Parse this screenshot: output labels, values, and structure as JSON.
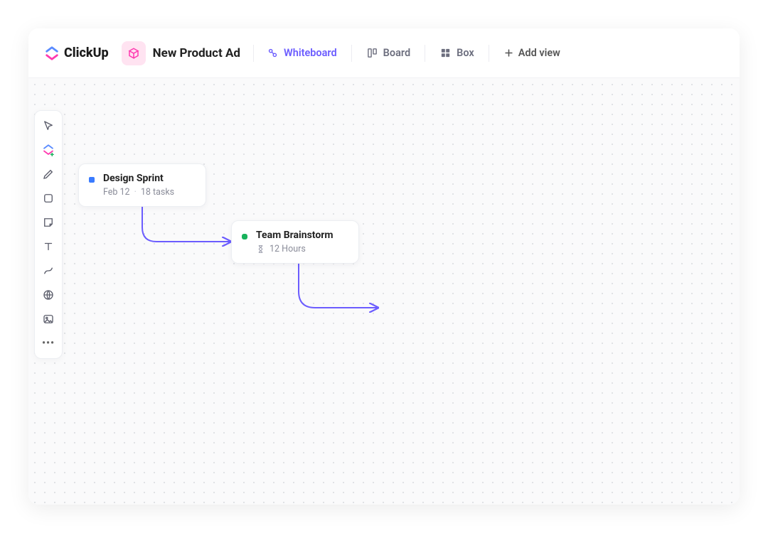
{
  "app": {
    "name": "ClickUp"
  },
  "project": {
    "name": "New Product Ad"
  },
  "tabs": {
    "whiteboard": "Whiteboard",
    "board": "Board",
    "box": "Box",
    "add": "Add view"
  },
  "toolbox": {
    "cursor": "cursor",
    "clickup": "clickup-shape",
    "pen": "pen",
    "rect": "rectangle",
    "note": "sticky-note",
    "text": "text",
    "connector": "connector",
    "web": "web-embed",
    "image": "image",
    "more": "more"
  },
  "cards": {
    "c1": {
      "title": "Design Sprint",
      "date": "Feb 12",
      "tasks": "18 tasks"
    },
    "c2": {
      "title": "Team Brainstorm",
      "time": "12 Hours"
    }
  },
  "colors": {
    "accent": "#6b5cff",
    "pink": "#ff3ab0",
    "connector": "#6b5cff"
  }
}
